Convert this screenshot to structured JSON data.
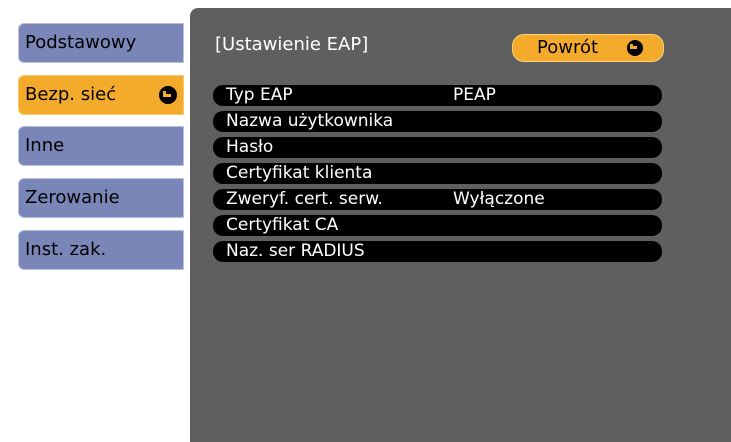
{
  "sidebar": {
    "items": [
      {
        "label": "Podstawowy",
        "active": false
      },
      {
        "label": "Bezp. sieć",
        "active": true
      },
      {
        "label": "Inne",
        "active": false
      },
      {
        "label": "Zerowanie",
        "active": false
      },
      {
        "label": "Inst. zak.",
        "active": false
      }
    ]
  },
  "panel": {
    "title": "[Ustawienie EAP]",
    "back_label": "Powrót",
    "rows": [
      {
        "label": "Typ EAP",
        "value": "PEAP"
      },
      {
        "label": "Nazwa użytkownika",
        "value": ""
      },
      {
        "label": "Hasło",
        "value": ""
      },
      {
        "label": "Certyfikat klienta",
        "value": ""
      },
      {
        "label": "Zweryf. cert. serw.",
        "value": "Wyłączone"
      },
      {
        "label": "Certyfikat CA",
        "value": ""
      },
      {
        "label": "Naz. ser RADIUS",
        "value": ""
      }
    ]
  },
  "colors": {
    "accent": "#f4aa2a",
    "sidebar": "#7a86b8",
    "panel": "#5f5f5f",
    "row": "#000000"
  },
  "icons": {
    "enter": "enter-icon"
  }
}
